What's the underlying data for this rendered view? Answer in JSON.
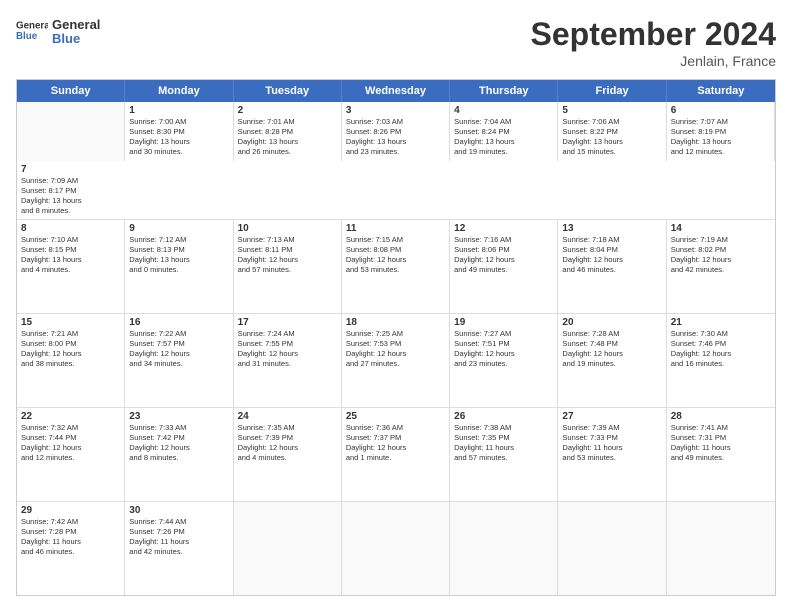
{
  "header": {
    "title": "September 2024",
    "location": "Jenlain, France",
    "logo_line1": "General",
    "logo_line2": "Blue"
  },
  "weekdays": [
    "Sunday",
    "Monday",
    "Tuesday",
    "Wednesday",
    "Thursday",
    "Friday",
    "Saturday"
  ],
  "rows": [
    [
      {
        "day": "",
        "empty": true
      },
      {
        "day": "1",
        "line1": "Sunrise: 7:00 AM",
        "line2": "Sunset: 8:30 PM",
        "line3": "Daylight: 13 hours",
        "line4": "and 30 minutes."
      },
      {
        "day": "2",
        "line1": "Sunrise: 7:01 AM",
        "line2": "Sunset: 8:28 PM",
        "line3": "Daylight: 13 hours",
        "line4": "and 26 minutes."
      },
      {
        "day": "3",
        "line1": "Sunrise: 7:03 AM",
        "line2": "Sunset: 8:26 PM",
        "line3": "Daylight: 13 hours",
        "line4": "and 23 minutes."
      },
      {
        "day": "4",
        "line1": "Sunrise: 7:04 AM",
        "line2": "Sunset: 8:24 PM",
        "line3": "Daylight: 13 hours",
        "line4": "and 19 minutes."
      },
      {
        "day": "5",
        "line1": "Sunrise: 7:06 AM",
        "line2": "Sunset: 8:22 PM",
        "line3": "Daylight: 13 hours",
        "line4": "and 15 minutes."
      },
      {
        "day": "6",
        "line1": "Sunrise: 7:07 AM",
        "line2": "Sunset: 8:19 PM",
        "line3": "Daylight: 13 hours",
        "line4": "and 12 minutes."
      },
      {
        "day": "7",
        "line1": "Sunrise: 7:09 AM",
        "line2": "Sunset: 8:17 PM",
        "line3": "Daylight: 13 hours",
        "line4": "and 8 minutes."
      }
    ],
    [
      {
        "day": "8",
        "line1": "Sunrise: 7:10 AM",
        "line2": "Sunset: 8:15 PM",
        "line3": "Daylight: 13 hours",
        "line4": "and 4 minutes."
      },
      {
        "day": "9",
        "line1": "Sunrise: 7:12 AM",
        "line2": "Sunset: 8:13 PM",
        "line3": "Daylight: 13 hours",
        "line4": "and 0 minutes."
      },
      {
        "day": "10",
        "line1": "Sunrise: 7:13 AM",
        "line2": "Sunset: 8:11 PM",
        "line3": "Daylight: 12 hours",
        "line4": "and 57 minutes."
      },
      {
        "day": "11",
        "line1": "Sunrise: 7:15 AM",
        "line2": "Sunset: 8:08 PM",
        "line3": "Daylight: 12 hours",
        "line4": "and 53 minutes."
      },
      {
        "day": "12",
        "line1": "Sunrise: 7:16 AM",
        "line2": "Sunset: 8:06 PM",
        "line3": "Daylight: 12 hours",
        "line4": "and 49 minutes."
      },
      {
        "day": "13",
        "line1": "Sunrise: 7:18 AM",
        "line2": "Sunset: 8:04 PM",
        "line3": "Daylight: 12 hours",
        "line4": "and 46 minutes."
      },
      {
        "day": "14",
        "line1": "Sunrise: 7:19 AM",
        "line2": "Sunset: 8:02 PM",
        "line3": "Daylight: 12 hours",
        "line4": "and 42 minutes."
      }
    ],
    [
      {
        "day": "15",
        "line1": "Sunrise: 7:21 AM",
        "line2": "Sunset: 8:00 PM",
        "line3": "Daylight: 12 hours",
        "line4": "and 38 minutes."
      },
      {
        "day": "16",
        "line1": "Sunrise: 7:22 AM",
        "line2": "Sunset: 7:57 PM",
        "line3": "Daylight: 12 hours",
        "line4": "and 34 minutes."
      },
      {
        "day": "17",
        "line1": "Sunrise: 7:24 AM",
        "line2": "Sunset: 7:55 PM",
        "line3": "Daylight: 12 hours",
        "line4": "and 31 minutes."
      },
      {
        "day": "18",
        "line1": "Sunrise: 7:25 AM",
        "line2": "Sunset: 7:53 PM",
        "line3": "Daylight: 12 hours",
        "line4": "and 27 minutes."
      },
      {
        "day": "19",
        "line1": "Sunrise: 7:27 AM",
        "line2": "Sunset: 7:51 PM",
        "line3": "Daylight: 12 hours",
        "line4": "and 23 minutes."
      },
      {
        "day": "20",
        "line1": "Sunrise: 7:28 AM",
        "line2": "Sunset: 7:48 PM",
        "line3": "Daylight: 12 hours",
        "line4": "and 19 minutes."
      },
      {
        "day": "21",
        "line1": "Sunrise: 7:30 AM",
        "line2": "Sunset: 7:46 PM",
        "line3": "Daylight: 12 hours",
        "line4": "and 16 minutes."
      }
    ],
    [
      {
        "day": "22",
        "line1": "Sunrise: 7:32 AM",
        "line2": "Sunset: 7:44 PM",
        "line3": "Daylight: 12 hours",
        "line4": "and 12 minutes."
      },
      {
        "day": "23",
        "line1": "Sunrise: 7:33 AM",
        "line2": "Sunset: 7:42 PM",
        "line3": "Daylight: 12 hours",
        "line4": "and 8 minutes."
      },
      {
        "day": "24",
        "line1": "Sunrise: 7:35 AM",
        "line2": "Sunset: 7:39 PM",
        "line3": "Daylight: 12 hours",
        "line4": "and 4 minutes."
      },
      {
        "day": "25",
        "line1": "Sunrise: 7:36 AM",
        "line2": "Sunset: 7:37 PM",
        "line3": "Daylight: 12 hours",
        "line4": "and 1 minute."
      },
      {
        "day": "26",
        "line1": "Sunrise: 7:38 AM",
        "line2": "Sunset: 7:35 PM",
        "line3": "Daylight: 11 hours",
        "line4": "and 57 minutes."
      },
      {
        "day": "27",
        "line1": "Sunrise: 7:39 AM",
        "line2": "Sunset: 7:33 PM",
        "line3": "Daylight: 11 hours",
        "line4": "and 53 minutes."
      },
      {
        "day": "28",
        "line1": "Sunrise: 7:41 AM",
        "line2": "Sunset: 7:31 PM",
        "line3": "Daylight: 11 hours",
        "line4": "and 49 minutes."
      }
    ],
    [
      {
        "day": "29",
        "line1": "Sunrise: 7:42 AM",
        "line2": "Sunset: 7:28 PM",
        "line3": "Daylight: 11 hours",
        "line4": "and 46 minutes."
      },
      {
        "day": "30",
        "line1": "Sunrise: 7:44 AM",
        "line2": "Sunset: 7:26 PM",
        "line3": "Daylight: 11 hours",
        "line4": "and 42 minutes."
      },
      {
        "day": "",
        "empty": true
      },
      {
        "day": "",
        "empty": true
      },
      {
        "day": "",
        "empty": true
      },
      {
        "day": "",
        "empty": true
      },
      {
        "day": "",
        "empty": true
      }
    ]
  ]
}
